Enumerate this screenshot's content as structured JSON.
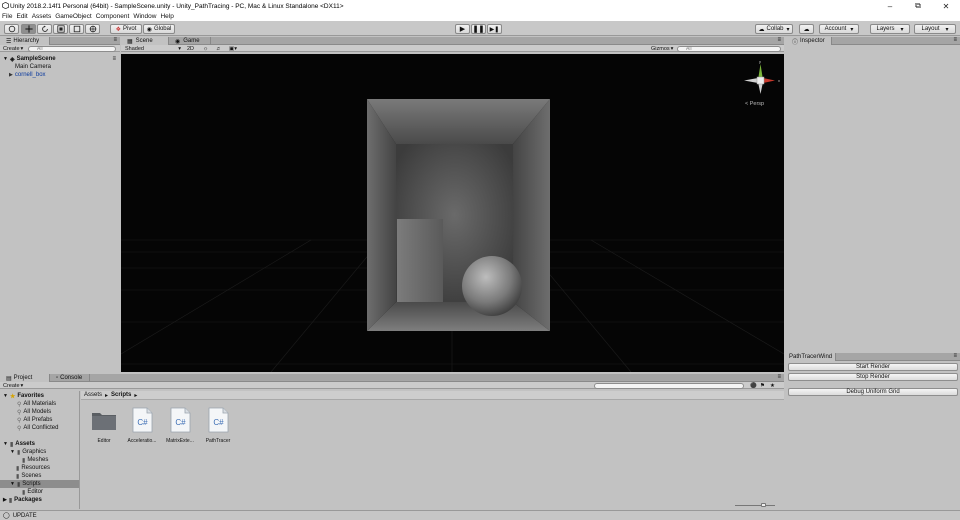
{
  "window": {
    "title": "Unity 2018.2.14f1 Personal (64bit) - SampleScene.unity - Unity_PathTracing - PC, Mac & Linux Standalone <DX11>"
  },
  "menu": [
    "File",
    "Edit",
    "Assets",
    "GameObject",
    "Component",
    "Window",
    "Help"
  ],
  "toolbar": {
    "pivot": "Pivot",
    "global": "Global",
    "collab": "Collab",
    "account": "Account",
    "layers": "Layers",
    "layout": "Layout"
  },
  "hierarchy": {
    "tab": "Hierarchy",
    "create": "Create",
    "search_placeholder": "All",
    "scene": "SampleScene",
    "items": [
      "Main Camera",
      "cornell_box"
    ]
  },
  "scene": {
    "tab_scene": "Scene",
    "tab_game": "Game",
    "shading": "Shaded",
    "mode_2d": "2D",
    "gizmos": "Gizmos",
    "search_placeholder": "All",
    "persp": "Persp"
  },
  "inspector": {
    "tab": "Inspector",
    "window_tab": "PathTracerWind",
    "buttons": [
      "Start Render",
      "Stop Render",
      "Debug Uniform Grid"
    ]
  },
  "project": {
    "tab_project": "Project",
    "tab_console": "Console",
    "create": "Create",
    "favorites": "Favorites",
    "favorites_items": [
      "All Materials",
      "All Models",
      "All Prefabs",
      "All Conflicted"
    ],
    "assets": "Assets",
    "assets_tree": [
      "Graphics",
      "Meshes",
      "Resources",
      "Scenes",
      "Scripts",
      "Editor"
    ],
    "packages": "Packages",
    "breadcrumb_root": "Assets",
    "breadcrumb_current": "Scripts",
    "files": [
      {
        "name": "Editor",
        "kind": "folder"
      },
      {
        "name": "Acceleratio...",
        "kind": "cs"
      },
      {
        "name": "MatrixExte...",
        "kind": "cs"
      },
      {
        "name": "PathTracer",
        "kind": "cs"
      }
    ],
    "cs_glyph": "C#"
  },
  "status": {
    "text": "UPDATE"
  }
}
